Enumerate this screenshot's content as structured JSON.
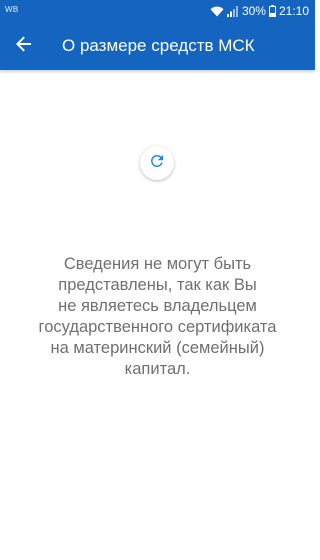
{
  "status_bar": {
    "carrier_label": "WB",
    "battery_percent": "30%",
    "time": "21:10",
    "icons": [
      "wifi-icon",
      "signal-icon",
      "battery-icon"
    ]
  },
  "app_bar": {
    "title": "О размере средств МСК",
    "back_icon": "arrow-back-icon"
  },
  "content": {
    "refresh_icon": "refresh-icon",
    "message": "Сведения не могут быть\nпредставлены, так как Вы\nне являетесь владельцем\nгосударственного сертификата\nна материнский (семейный)\nкапитал."
  },
  "colors": {
    "primary": "#1565c0",
    "message_text": "#6f6f6f",
    "accent_icon": "#1e88e5"
  }
}
